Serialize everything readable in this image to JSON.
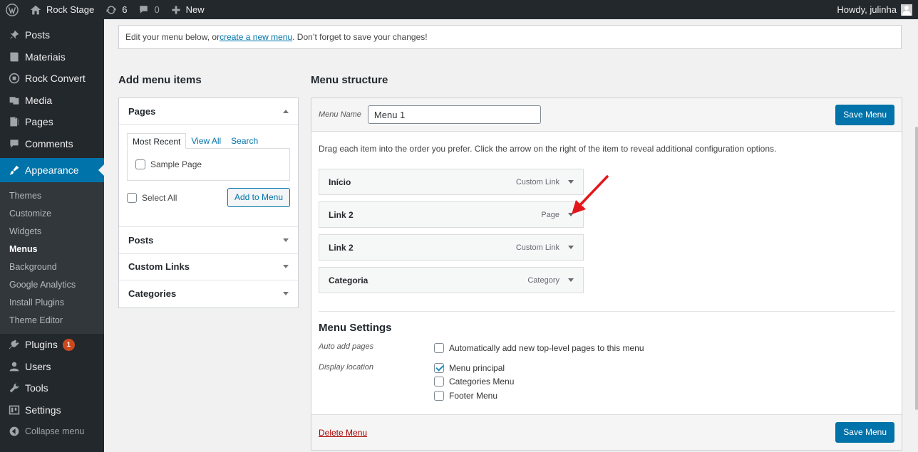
{
  "adminbar": {
    "site_name": "Rock Stage",
    "updates_count": "6",
    "comments_count": "0",
    "new_label": "New",
    "greeting": "Howdy, julinha"
  },
  "sidebar": {
    "items_top": [
      {
        "label": "Posts",
        "icon": "pin-icon"
      },
      {
        "label": "Materiais",
        "icon": "book-icon"
      },
      {
        "label": "Rock Convert",
        "icon": "circle-icon"
      },
      {
        "label": "Media",
        "icon": "media-icon"
      },
      {
        "label": "Pages",
        "icon": "page-icon"
      },
      {
        "label": "Comments",
        "icon": "comment-icon"
      }
    ],
    "current": {
      "label": "Appearance",
      "icon": "brush-icon"
    },
    "submenu": [
      "Themes",
      "Customize",
      "Widgets",
      "Menus",
      "Background",
      "Google Analytics",
      "Install Plugins",
      "Theme Editor"
    ],
    "active_submenu": "Menus",
    "items_bottom": [
      {
        "label": "Plugins",
        "icon": "plug-icon",
        "badge": "1"
      },
      {
        "label": "Users",
        "icon": "user-icon"
      },
      {
        "label": "Tools",
        "icon": "wrench-icon"
      },
      {
        "label": "Settings",
        "icon": "settings-icon"
      }
    ],
    "collapse_label": "Collapse menu"
  },
  "notice": {
    "before": "Edit your menu below, or ",
    "link": "create a new menu",
    "after": ". Don’t forget to save your changes!"
  },
  "add_items": {
    "heading": "Add menu items",
    "pages_label": "Pages",
    "tabs": [
      "Most Recent",
      "View All",
      "Search"
    ],
    "page_options": [
      "Sample Page"
    ],
    "select_all": "Select All",
    "add_button": "Add to Menu",
    "sections": [
      "Posts",
      "Custom Links",
      "Categories"
    ]
  },
  "structure": {
    "heading": "Menu structure",
    "menu_name_label": "Menu Name",
    "menu_name_value": "Menu 1",
    "save_label": "Save Menu",
    "instructions": "Drag each item into the order you prefer. Click the arrow on the right of the item to reveal additional configuration options.",
    "items": [
      {
        "title": "Início",
        "type": "Custom Link"
      },
      {
        "title": "Link 2",
        "type": "Page"
      },
      {
        "title": "Link 2",
        "type": "Custom Link"
      },
      {
        "title": "Categoria",
        "type": "Category"
      }
    ]
  },
  "settings": {
    "title": "Menu Settings",
    "auto_add_label": "Auto add pages",
    "auto_add_option": "Automatically add new top-level pages to this menu",
    "auto_add_checked": false,
    "display_label": "Display location",
    "locations": [
      {
        "label": "Menu principal",
        "checked": true
      },
      {
        "label": "Categories Menu",
        "checked": false
      },
      {
        "label": "Footer Menu",
        "checked": false
      }
    ]
  },
  "footer": {
    "delete_label": "Delete Menu",
    "save_label": "Save Menu"
  },
  "colors": {
    "accent": "#0073aa",
    "sidebar_bg": "#23282d",
    "annotation_arrow": "#e3171b"
  }
}
